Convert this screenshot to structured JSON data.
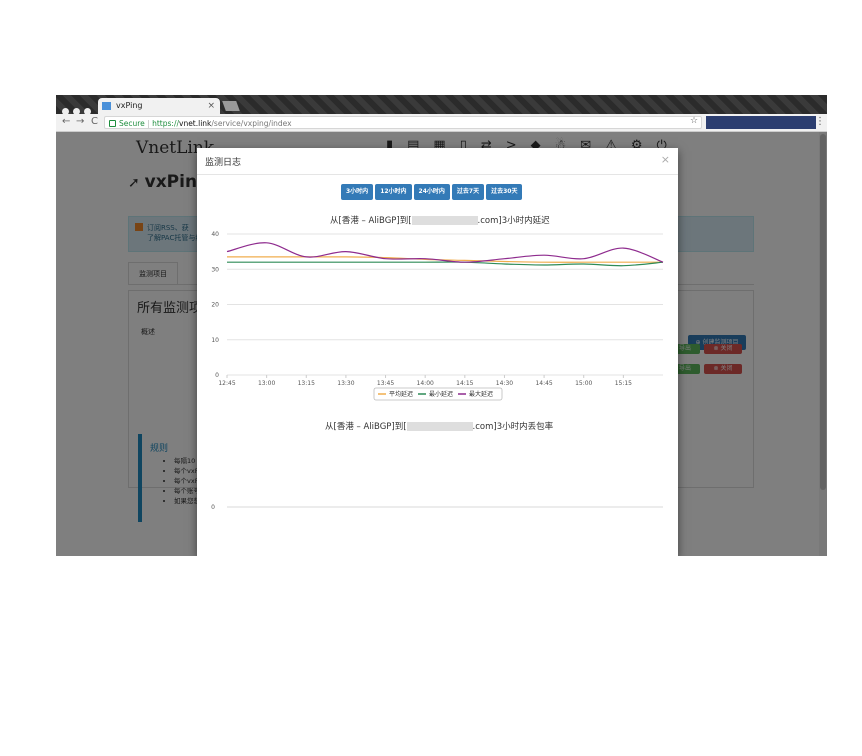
{
  "browser": {
    "tab_title": "vxPing",
    "tab_close": "×",
    "url_secure": "Secure",
    "url_scheme": "https://",
    "url_host": "vnet.link",
    "url_path": "/service/vxping/index",
    "back": "←",
    "forward": "→",
    "reload": "C",
    "star": "☆",
    "menu": "⋮"
  },
  "site": {
    "logo": "VnetLink",
    "top_icons": "▮▤▦▯⇄>◆☃✉⚠⚙⏻",
    "page_title": "vxPin",
    "rss_text_1": "订阅RSS、获",
    "rss_text_2": "了解PAC托管与编",
    "tab_label": "监测项目",
    "panel_title": "所有监测项",
    "panel_col": "概述",
    "create_button": "创建监测项目",
    "row_export": "导出",
    "row_close": "关闭",
    "rules_title": "规则",
    "rules": [
      "每隔10",
      "每个vxF",
      "每个vxF",
      "每个账号",
      "如果您想"
    ]
  },
  "modal": {
    "title": "监测日志",
    "close": "×",
    "range_buttons": [
      "3小时内",
      "12小时内",
      "24小时内",
      "过去7天",
      "过去30天"
    ]
  },
  "chart_data": [
    {
      "type": "line",
      "title_prefix": "从[香港 – AliBGP]到[",
      "title_suffix": ".com]3小时内延迟",
      "x": [
        "12:45",
        "13:00",
        "13:15",
        "13:30",
        "13:45",
        "14:00",
        "14:15",
        "14:30",
        "14:45",
        "15:00",
        "15:15"
      ],
      "x_ticks": [
        "12:45",
        "13:00",
        "13:15",
        "13:30",
        "13:45",
        "14:00",
        "14:15",
        "14:30",
        "14:45",
        "15:00",
        "15:15"
      ],
      "x_range": [
        "12:45",
        "15:30"
      ],
      "ylim": [
        0,
        40
      ],
      "yticks": [
        0,
        10,
        20,
        30,
        40
      ],
      "grid": true,
      "legend_position": "bottom",
      "series": [
        {
          "name": "平均延迟",
          "color": "#f0ad4e",
          "values": [
            33.5,
            33.5,
            33.5,
            33.5,
            33.3,
            32.8,
            32.5,
            32.2,
            32.0,
            32.0,
            32.0,
            32.0
          ]
        },
        {
          "name": "最小延迟",
          "color": "#2e8b57",
          "values": [
            32.0,
            32.0,
            32.0,
            32.0,
            32.0,
            32.0,
            32.0,
            31.5,
            31.2,
            31.5,
            31.0,
            32.0
          ]
        },
        {
          "name": "最大延迟",
          "color": "#8e2b8e",
          "values": [
            35.0,
            37.5,
            33.5,
            35.0,
            33.0,
            33.0,
            32.0,
            33.0,
            34.0,
            33.0,
            36.0,
            32.0
          ]
        }
      ]
    },
    {
      "type": "line",
      "title_prefix": "从[香港 – AliBGP]到[",
      "title_suffix": ".com]3小时内丢包率",
      "yticks": [
        0
      ],
      "series": []
    }
  ]
}
